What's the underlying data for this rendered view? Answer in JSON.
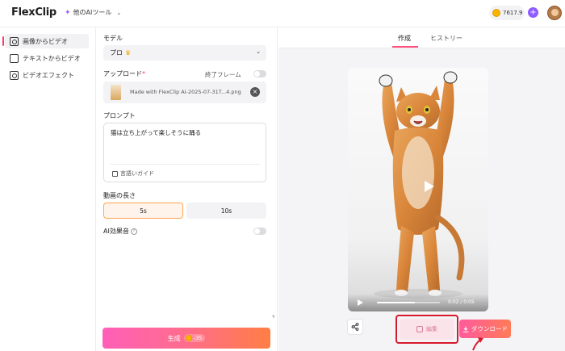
{
  "header": {
    "logo": "FlexClip",
    "ai_tools": "他のAIツール",
    "credits": "7617.9"
  },
  "sidebar": {
    "items": [
      {
        "label": "画像からビデオ",
        "active": true,
        "icon": "image-video-icon"
      },
      {
        "label": "テキストからビデオ",
        "active": false,
        "icon": "text-video-icon"
      },
      {
        "label": "ビデオエフェクト",
        "active": false,
        "icon": "video-effect-icon"
      }
    ]
  },
  "form": {
    "model_label": "モデル",
    "model_value": "プロ",
    "upload_label": "アップロード",
    "end_frame_label": "終了フレーム",
    "upload_filename": "Made with FlexClip AI-2025-07-31T...4.png",
    "prompt_label": "プロンプト",
    "prompt_text": "猫は立ち上がって楽しそうに踊る",
    "guide_label": "言語いガイド",
    "duration_label": "動画の長さ",
    "duration_options": [
      "5s",
      "10s"
    ],
    "duration_selected": "5s",
    "ai_sound_label": "AI効果音",
    "generate_label": "生成",
    "generate_cost": "-35"
  },
  "preview": {
    "tabs": [
      "作成",
      "ヒストリー"
    ],
    "active_tab": "作成",
    "time": "0:02 / 0:05",
    "progress": 0.6,
    "edit_label": "編集",
    "download_label": "ダウンロード"
  },
  "colors": {
    "accent_pink": "#ff4f7a",
    "highlight_red": "#d8182c",
    "selected_orange": "#ffa552"
  }
}
